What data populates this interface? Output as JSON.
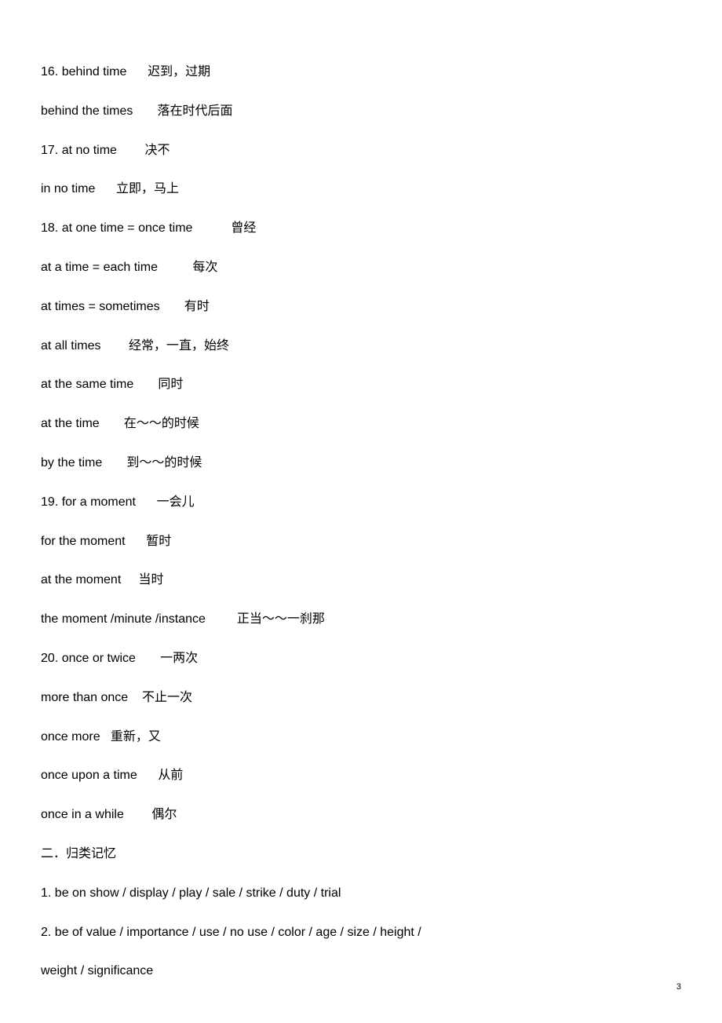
{
  "lines": [
    "16. behind time      迟到，过期",
    "behind the times       落在时代后面",
    "17. at no time        决不",
    "in no time      立即，马上",
    "18. at one time = once time           曾经",
    "at a time = each time          每次",
    "at times = sometimes       有时",
    "at all times        经常，一直，始终",
    "at the same time       同时",
    "at the time       在～～的时候",
    "by the time       到～～的时候",
    "19. for a moment      一会儿",
    "for the moment      暂时",
    "at the moment     当时",
    "the moment /minute /instance         正当～～一刹那",
    "20. once or twice       一两次",
    "more than once    不止一次",
    "once more   重新，又",
    "once upon a time      从前",
    "once in a while        偶尔",
    "二．归类记忆",
    "1. be on show / display / play / sale / strike / duty / trial",
    "2. be of value / importance / use / no use / color / age / size / height /",
    "weight / significance"
  ],
  "pageNumber": "3"
}
